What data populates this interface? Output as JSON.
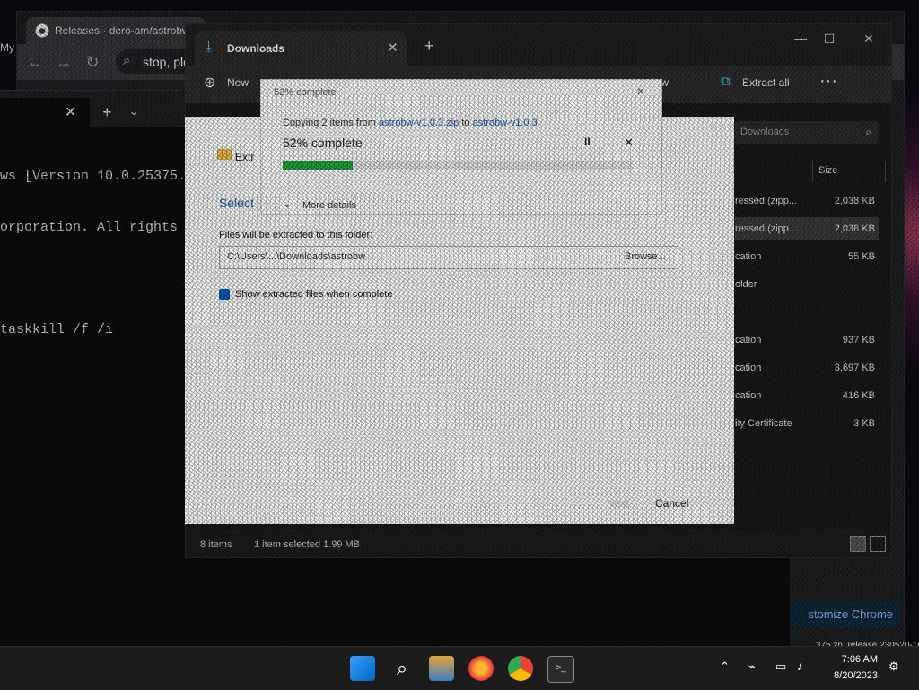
{
  "chrome": {
    "tab_title": "Releases · dero-am/astrobw",
    "omnibox_text": "stop, ple",
    "sidebar_text": "My",
    "customize_label": "stomize Chrome",
    "footer_line1": "ew",
    "footer_line2": "375.zn_release.230520-1632"
  },
  "terminal": {
    "lines": [
      "ws [Version 10.0.25375.",
      "orporation. All rights",
      "",
      "taskkill /f /i"
    ]
  },
  "explorer": {
    "tab_label": "Downloads",
    "new_label": "New",
    "view_label": "iew",
    "extract_all_label": "Extract all",
    "search_placeholder": "Downloads",
    "size_header": "Size",
    "rows": [
      {
        "type": "ressed (zipp...",
        "size": "2,038 KB",
        "selected": false
      },
      {
        "type": "ressed (zipp...",
        "size": "2,038 KB",
        "selected": true
      },
      {
        "type": "cation",
        "size": "55 KB",
        "selected": false
      },
      {
        "type": "older",
        "size": "",
        "selected": false
      },
      {
        "type": "",
        "size": "",
        "selected": false
      },
      {
        "type": "cation",
        "size": "937 KB",
        "selected": false
      },
      {
        "type": "cation",
        "size": "3,697 KB",
        "selected": false
      },
      {
        "type": "cation",
        "size": "416 KB",
        "selected": false
      },
      {
        "type": "ity Certificate",
        "size": "3 KB",
        "selected": false
      }
    ],
    "status_items": "8 items",
    "status_selected": "1 item selected  1.99 MB"
  },
  "extract_dialog": {
    "title": "Extr",
    "select_heading": "Select",
    "files_label": "Files will be extracted to this folder:",
    "path_value": "C:\\Users\\...\\Downloads\\astrobw",
    "browse_label": "Browse...",
    "show_files_label": "Show extracted files when complete",
    "next_label": "Next",
    "cancel_label": "Cancel"
  },
  "progress_dialog": {
    "title": "52% complete",
    "copying_text": "Copying 2 items from",
    "copying_from": "astrobw-v1.0.3.zip",
    "copying_to_word": "to",
    "copying_to": "astrobw-v1.0.3",
    "percent_text": "52% complete",
    "progress": 0.2,
    "more_details_label": "More details",
    "pause_symbol": "II",
    "cancel_symbol": "✕"
  },
  "taskbar": {
    "time": "7:06 AM",
    "date": "8/20/2023"
  },
  "colors": {
    "accent": "#4cc2ff",
    "progress_fill": "#22a33a",
    "link": "#1a5fb4"
  }
}
